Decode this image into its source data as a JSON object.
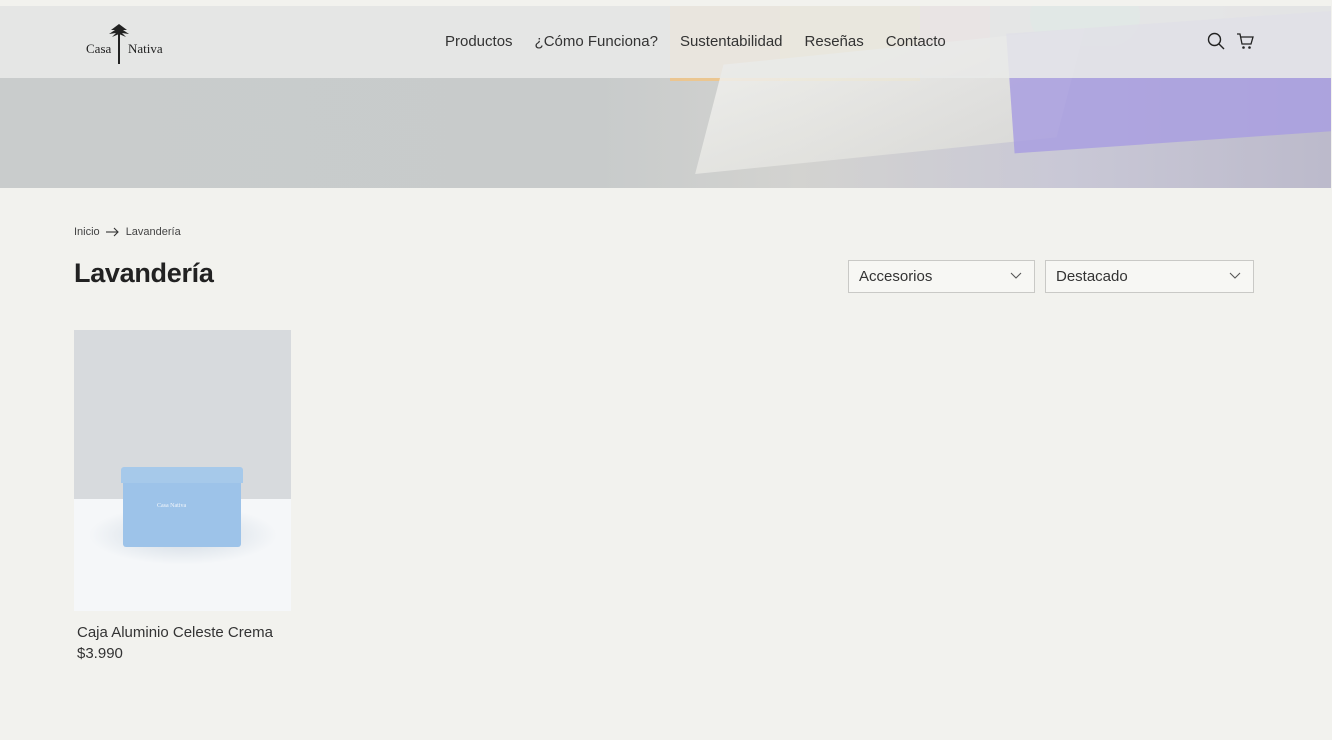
{
  "header": {
    "logo": {
      "left": "Casa",
      "right": "Nativa"
    },
    "nav": [
      "Productos",
      "¿Cómo Funciona?",
      "Sustentabilidad",
      "Reseñas",
      "Contacto"
    ],
    "icons": [
      "search-icon",
      "cart-icon"
    ]
  },
  "breadcrumb": {
    "home": "Inicio",
    "current": "Lavandería"
  },
  "page": {
    "title": "Lavandería"
  },
  "filters": {
    "category": "Accesorios",
    "sort": "Destacado"
  },
  "products": [
    {
      "name": "Caja Aluminio Celeste Crema",
      "price": "$3.990",
      "image_label": "Casa Nativa"
    }
  ],
  "colors": {
    "background": "#f2f2ee",
    "tin": "#9dc3e9",
    "text": "#222222"
  }
}
